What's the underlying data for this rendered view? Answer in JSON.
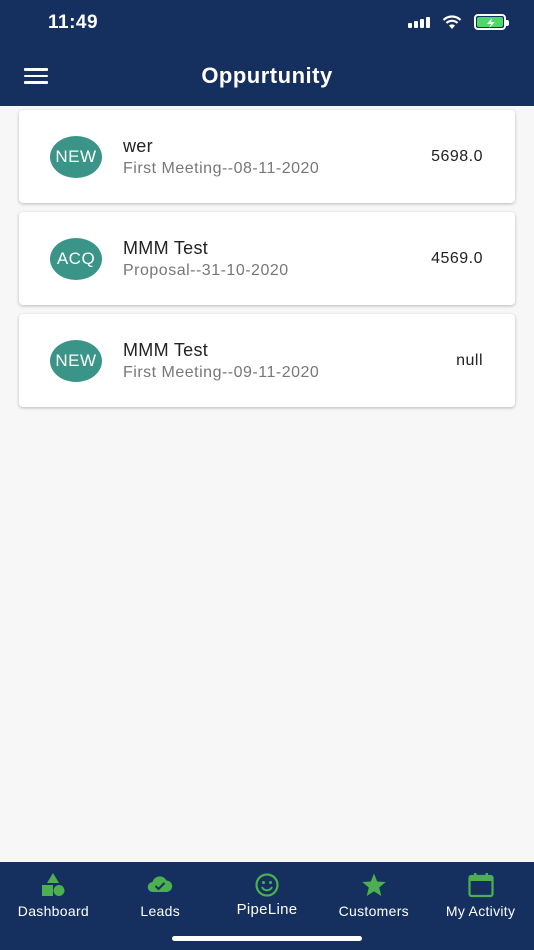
{
  "status_bar": {
    "time": "11:49"
  },
  "header": {
    "title": "Oppurtunity",
    "menu_icon": "hamburger-icon"
  },
  "opportunities": [
    {
      "badge": "NEW",
      "name": "wer",
      "stage": "First Meeting--08-11-2020",
      "amount": "5698.0"
    },
    {
      "badge": "ACQ",
      "name": "MMM Test",
      "stage": "Proposal--31-10-2020",
      "amount": "4569.0"
    },
    {
      "badge": "NEW",
      "name": "MMM Test",
      "stage": "First Meeting--09-11-2020",
      "amount": "null"
    }
  ],
  "bottom_nav": [
    {
      "label": "Dashboard",
      "icon": "shapes-icon"
    },
    {
      "label": "Leads",
      "icon": "cloud-check-icon"
    },
    {
      "label": "PipeLine",
      "icon": "smiley-icon",
      "active": true
    },
    {
      "label": "Customers",
      "icon": "star-icon"
    },
    {
      "label": "My Activity",
      "icon": "calendar-icon"
    }
  ],
  "colors": {
    "header_bg": "#15305f",
    "badge_bg": "#3a9487",
    "nav_icon": "#4caf50",
    "battery_fill": "#4cd964"
  }
}
